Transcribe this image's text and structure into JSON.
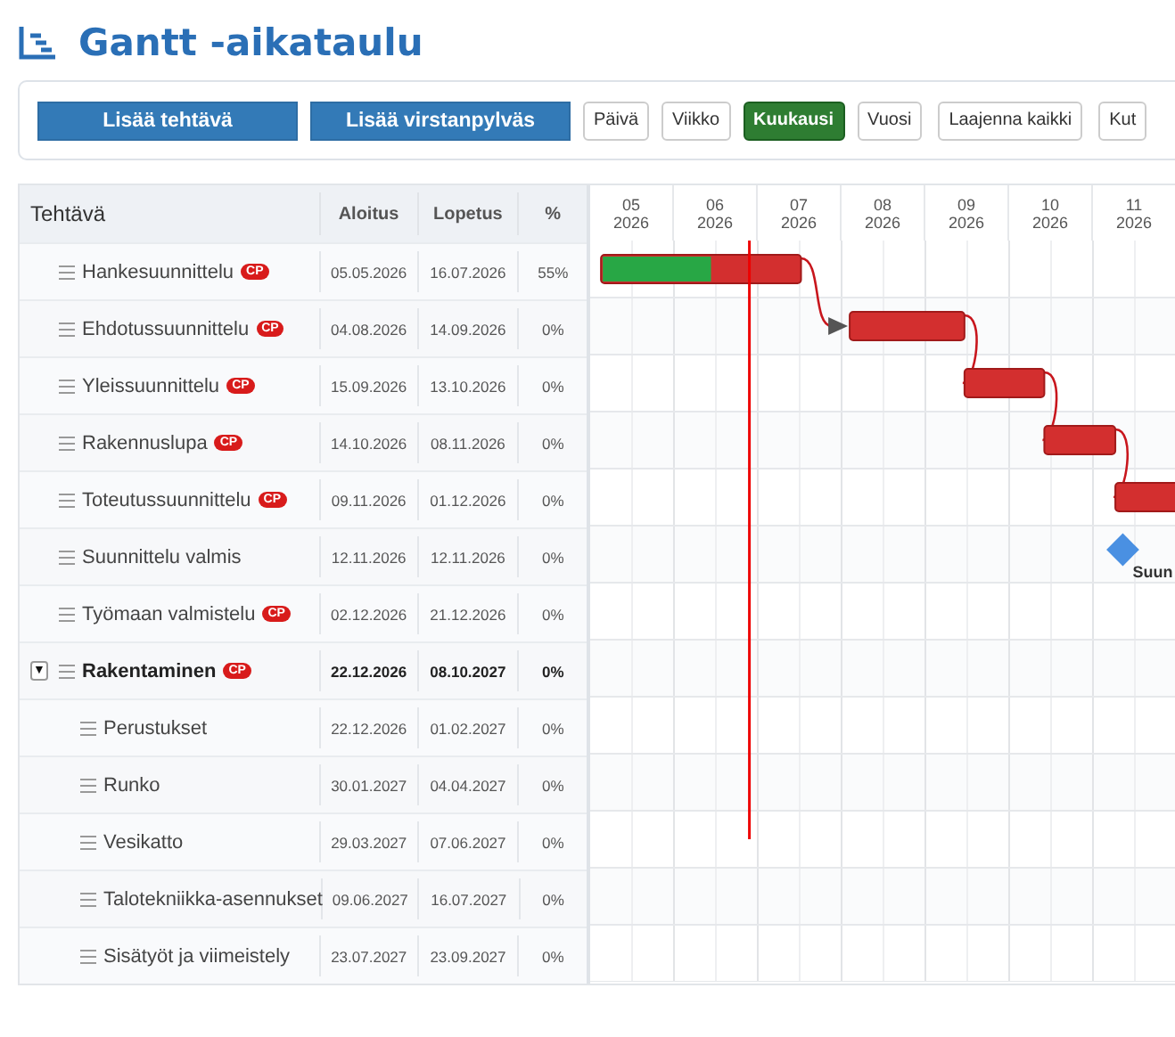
{
  "title": "Gantt -aikataulu",
  "toolbar": {
    "actions": [
      "Lisää tehtävä",
      "Lisää virstanpylväs"
    ],
    "views": [
      {
        "label": "Päivä",
        "selected": false
      },
      {
        "label": "Viikko",
        "selected": false
      },
      {
        "label": "Kuukausi",
        "selected": true
      },
      {
        "label": "Vuosi",
        "selected": false
      }
    ],
    "extra": [
      "Laajenna kaikki",
      "Kut"
    ]
  },
  "table": {
    "columns": [
      "Tehtävä",
      "Aloitus",
      "Lopetus",
      "%"
    ],
    "rows": [
      {
        "kind": "task",
        "name": "Hankesuunnittelu",
        "badge": "CP",
        "start": "05.05.2026",
        "end": "16.07.2026",
        "percent": "55%",
        "level": 0.55,
        "links_next": true,
        "arrowhead": true
      },
      {
        "kind": "task",
        "name": "Ehdotussuunnittelu",
        "badge": "CP",
        "start": "04.08.2026",
        "end": "14.09.2026",
        "percent": "0%",
        "links_next": true,
        "arrowhead": false
      },
      {
        "kind": "task",
        "name": "Yleissuunnittelu",
        "badge": "CP",
        "start": "15.09.2026",
        "end": "13.10.2026",
        "percent": "0%",
        "links_next": true,
        "arrowhead": false
      },
      {
        "kind": "task",
        "name": "Rakennuslupa",
        "badge": "CP",
        "start": "14.10.2026",
        "end": "08.11.2026",
        "percent": "0%",
        "links_next": true,
        "arrowhead": false
      },
      {
        "kind": "task",
        "name": "Toteutussuunnittelu",
        "badge": "CP",
        "start": "09.11.2026",
        "end": "01.12.2026",
        "percent": "0%"
      },
      {
        "kind": "milestone",
        "name": "Suunnittelu valmis",
        "start": "12.11.2026",
        "end": "12.11.2026",
        "percent": "0%",
        "chart_label": "Suun"
      },
      {
        "kind": "task",
        "name": "Työmaan valmistelu",
        "badge": "CP",
        "start": "02.12.2026",
        "end": "21.12.2026",
        "percent": "0%"
      },
      {
        "kind": "group",
        "name": "Rakentaminen",
        "badge": "CP",
        "start": "22.12.2026",
        "end": "08.10.2027",
        "percent": "0%",
        "expanded": true,
        "toggle": "▼",
        "children": [
          {
            "kind": "task",
            "name": "Perustukset",
            "start": "22.12.2026",
            "end": "01.02.2027",
            "percent": "0%"
          },
          {
            "kind": "task",
            "name": "Runko",
            "start": "30.01.2027",
            "end": "04.04.2027",
            "percent": "0%"
          },
          {
            "kind": "task",
            "name": "Vesikatto",
            "start": "29.03.2027",
            "end": "07.06.2027",
            "percent": "0%"
          },
          {
            "kind": "task",
            "name": "Talotekniikka-asennukset",
            "start": "09.06.2027",
            "end": "16.07.2027",
            "percent": "0%"
          },
          {
            "kind": "task",
            "name": "Sisätyöt ja viimeistely",
            "start": "23.07.2027",
            "end": "23.09.2027",
            "percent": "0%"
          }
        ]
      }
    ]
  },
  "timeline": {
    "months": [
      {
        "month": "05",
        "year": "2026"
      },
      {
        "month": "06",
        "year": "2026"
      },
      {
        "month": "07",
        "year": "2026"
      },
      {
        "month": "08",
        "year": "2026"
      },
      {
        "month": "09",
        "year": "2026"
      },
      {
        "month": "10",
        "year": "2026"
      },
      {
        "month": "11",
        "year": "2026"
      }
    ]
  }
}
